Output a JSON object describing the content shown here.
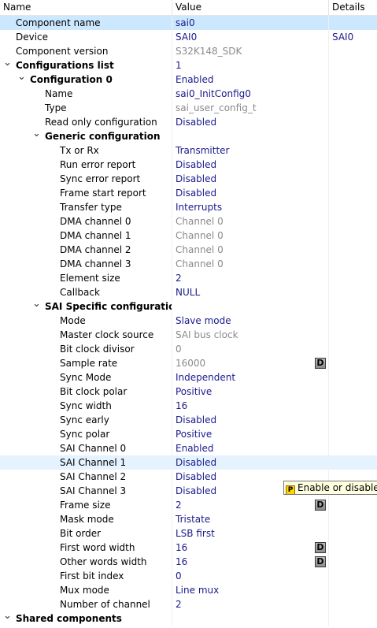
{
  "header": {
    "name": "Name",
    "value": "Value",
    "details": "Details"
  },
  "rows": [
    {
      "level": 0,
      "arrow": "",
      "name": "Component name",
      "value": "sai0",
      "details": "",
      "bold": false,
      "vstyle": "blue",
      "badge": false,
      "state": "sel"
    },
    {
      "level": 0,
      "arrow": "",
      "name": "Device",
      "value": "SAI0",
      "details": "SAI0",
      "bold": false,
      "vstyle": "blue",
      "badge": false,
      "state": ""
    },
    {
      "level": 0,
      "arrow": "",
      "name": "Component version",
      "value": "S32K148_SDK",
      "details": "",
      "bold": false,
      "vstyle": "gray",
      "badge": false,
      "state": ""
    },
    {
      "level": 0,
      "arrow": "v",
      "name": "Configurations list",
      "value": "1",
      "details": "",
      "bold": true,
      "vstyle": "blue",
      "badge": false,
      "state": ""
    },
    {
      "level": 1,
      "arrow": "v",
      "name": "Configuration 0",
      "value": "Enabled",
      "details": "",
      "bold": true,
      "vstyle": "blue",
      "badge": false,
      "state": ""
    },
    {
      "level": 2,
      "arrow": "",
      "name": "Name",
      "value": "sai0_InitConfig0",
      "details": "",
      "bold": false,
      "vstyle": "blue",
      "badge": false,
      "state": ""
    },
    {
      "level": 2,
      "arrow": "",
      "name": "Type",
      "value": "sai_user_config_t",
      "details": "",
      "bold": false,
      "vstyle": "gray",
      "badge": false,
      "state": ""
    },
    {
      "level": 2,
      "arrow": "",
      "name": "Read only configuration",
      "value": "Disabled",
      "details": "",
      "bold": false,
      "vstyle": "blue",
      "badge": false,
      "state": ""
    },
    {
      "level": 2,
      "arrow": "v",
      "name": "Generic configuration",
      "value": "",
      "details": "",
      "bold": true,
      "vstyle": "blue",
      "badge": false,
      "state": ""
    },
    {
      "level": 3,
      "arrow": "",
      "name": "Tx or Rx",
      "value": "Transmitter",
      "details": "",
      "bold": false,
      "vstyle": "blue",
      "badge": false,
      "state": ""
    },
    {
      "level": 3,
      "arrow": "",
      "name": "Run error report",
      "value": "Disabled",
      "details": "",
      "bold": false,
      "vstyle": "blue",
      "badge": false,
      "state": ""
    },
    {
      "level": 3,
      "arrow": "",
      "name": "Sync error report",
      "value": "Disabled",
      "details": "",
      "bold": false,
      "vstyle": "blue",
      "badge": false,
      "state": ""
    },
    {
      "level": 3,
      "arrow": "",
      "name": "Frame start report",
      "value": "Disabled",
      "details": "",
      "bold": false,
      "vstyle": "blue",
      "badge": false,
      "state": ""
    },
    {
      "level": 3,
      "arrow": "",
      "name": "Transfer type",
      "value": "Interrupts",
      "details": "",
      "bold": false,
      "vstyle": "blue",
      "badge": false,
      "state": ""
    },
    {
      "level": 3,
      "arrow": "",
      "name": "DMA channel 0",
      "value": "Channel 0",
      "details": "",
      "bold": false,
      "vstyle": "gray",
      "badge": false,
      "state": ""
    },
    {
      "level": 3,
      "arrow": "",
      "name": "DMA channel 1",
      "value": "Channel 0",
      "details": "",
      "bold": false,
      "vstyle": "gray",
      "badge": false,
      "state": ""
    },
    {
      "level": 3,
      "arrow": "",
      "name": "DMA channel 2",
      "value": "Channel 0",
      "details": "",
      "bold": false,
      "vstyle": "gray",
      "badge": false,
      "state": ""
    },
    {
      "level": 3,
      "arrow": "",
      "name": "DMA channel 3",
      "value": "Channel 0",
      "details": "",
      "bold": false,
      "vstyle": "gray",
      "badge": false,
      "state": ""
    },
    {
      "level": 3,
      "arrow": "",
      "name": "Element size",
      "value": "2",
      "details": "",
      "bold": false,
      "vstyle": "blue",
      "badge": false,
      "state": ""
    },
    {
      "level": 3,
      "arrow": "",
      "name": "Callback",
      "value": "NULL",
      "details": "",
      "bold": false,
      "vstyle": "blue",
      "badge": false,
      "state": ""
    },
    {
      "level": 2,
      "arrow": "v",
      "name": "SAI Specific configuration",
      "value": "",
      "details": "",
      "bold": true,
      "vstyle": "blue",
      "badge": false,
      "state": ""
    },
    {
      "level": 3,
      "arrow": "",
      "name": "Mode",
      "value": "Slave mode",
      "details": "",
      "bold": false,
      "vstyle": "blue",
      "badge": false,
      "state": ""
    },
    {
      "level": 3,
      "arrow": "",
      "name": "Master clock source",
      "value": "SAI bus clock",
      "details": "",
      "bold": false,
      "vstyle": "gray",
      "badge": false,
      "state": ""
    },
    {
      "level": 3,
      "arrow": "",
      "name": "Bit clock divisor",
      "value": "0",
      "details": "",
      "bold": false,
      "vstyle": "gray",
      "badge": false,
      "state": ""
    },
    {
      "level": 3,
      "arrow": "",
      "name": "Sample rate",
      "value": "16000",
      "details": "",
      "bold": false,
      "vstyle": "gray",
      "badge": true,
      "state": ""
    },
    {
      "level": 3,
      "arrow": "",
      "name": "Sync Mode",
      "value": "Independent",
      "details": "",
      "bold": false,
      "vstyle": "blue",
      "badge": false,
      "state": ""
    },
    {
      "level": 3,
      "arrow": "",
      "name": "Bit clock polar",
      "value": "Positive",
      "details": "",
      "bold": false,
      "vstyle": "blue",
      "badge": false,
      "state": ""
    },
    {
      "level": 3,
      "arrow": "",
      "name": "Sync width",
      "value": "16",
      "details": "",
      "bold": false,
      "vstyle": "blue",
      "badge": false,
      "state": ""
    },
    {
      "level": 3,
      "arrow": "",
      "name": "Sync early",
      "value": "Disabled",
      "details": "",
      "bold": false,
      "vstyle": "blue",
      "badge": false,
      "state": ""
    },
    {
      "level": 3,
      "arrow": "",
      "name": "Sync polar",
      "value": "Positive",
      "details": "",
      "bold": false,
      "vstyle": "blue",
      "badge": false,
      "state": ""
    },
    {
      "level": 3,
      "arrow": "",
      "name": "SAI Channel 0",
      "value": "Enabled",
      "details": "",
      "bold": false,
      "vstyle": "blue",
      "badge": false,
      "state": ""
    },
    {
      "level": 3,
      "arrow": "",
      "name": "SAI Channel 1",
      "value": "Disabled",
      "details": "",
      "bold": false,
      "vstyle": "blue",
      "badge": false,
      "state": "hov"
    },
    {
      "level": 3,
      "arrow": "",
      "name": "SAI Channel 2",
      "value": "Disabled",
      "details": "",
      "bold": false,
      "vstyle": "blue",
      "badge": false,
      "state": ""
    },
    {
      "level": 3,
      "arrow": "",
      "name": "SAI Channel 3",
      "value": "Disabled",
      "details": "",
      "bold": false,
      "vstyle": "blue",
      "badge": false,
      "state": ""
    },
    {
      "level": 3,
      "arrow": "",
      "name": "Frame size",
      "value": "2",
      "details": "",
      "bold": false,
      "vstyle": "blue",
      "badge": true,
      "state": ""
    },
    {
      "level": 3,
      "arrow": "",
      "name": "Mask mode",
      "value": "Tristate",
      "details": "",
      "bold": false,
      "vstyle": "blue",
      "badge": false,
      "state": ""
    },
    {
      "level": 3,
      "arrow": "",
      "name": "Bit order",
      "value": "LSB first",
      "details": "",
      "bold": false,
      "vstyle": "blue",
      "badge": false,
      "state": ""
    },
    {
      "level": 3,
      "arrow": "",
      "name": "First word width",
      "value": "16",
      "details": "",
      "bold": false,
      "vstyle": "blue",
      "badge": true,
      "state": ""
    },
    {
      "level": 3,
      "arrow": "",
      "name": "Other words width",
      "value": "16",
      "details": "",
      "bold": false,
      "vstyle": "blue",
      "badge": true,
      "state": ""
    },
    {
      "level": 3,
      "arrow": "",
      "name": "First bit index",
      "value": "0",
      "details": "",
      "bold": false,
      "vstyle": "blue",
      "badge": false,
      "state": ""
    },
    {
      "level": 3,
      "arrow": "",
      "name": "Mux mode",
      "value": "Line mux",
      "details": "",
      "bold": false,
      "vstyle": "blue",
      "badge": false,
      "state": ""
    },
    {
      "level": 3,
      "arrow": "",
      "name": "Number of channel",
      "value": "2",
      "details": "",
      "bold": false,
      "vstyle": "blue",
      "badge": false,
      "state": ""
    },
    {
      "level": 0,
      "arrow": "v",
      "name": "Shared components",
      "value": "",
      "details": "",
      "bold": true,
      "vstyle": "blue",
      "badge": false,
      "state": ""
    }
  ],
  "badge_text": "D",
  "tooltip": {
    "icon": "P",
    "text": "Enable or disable ch"
  },
  "colors": {
    "selected_row": "#cce8ff",
    "hover_row": "#e5f3ff",
    "value_blue": "#1a1a8c",
    "value_gray": "#8a8a8a",
    "tooltip_bg": "#ffffe1"
  }
}
